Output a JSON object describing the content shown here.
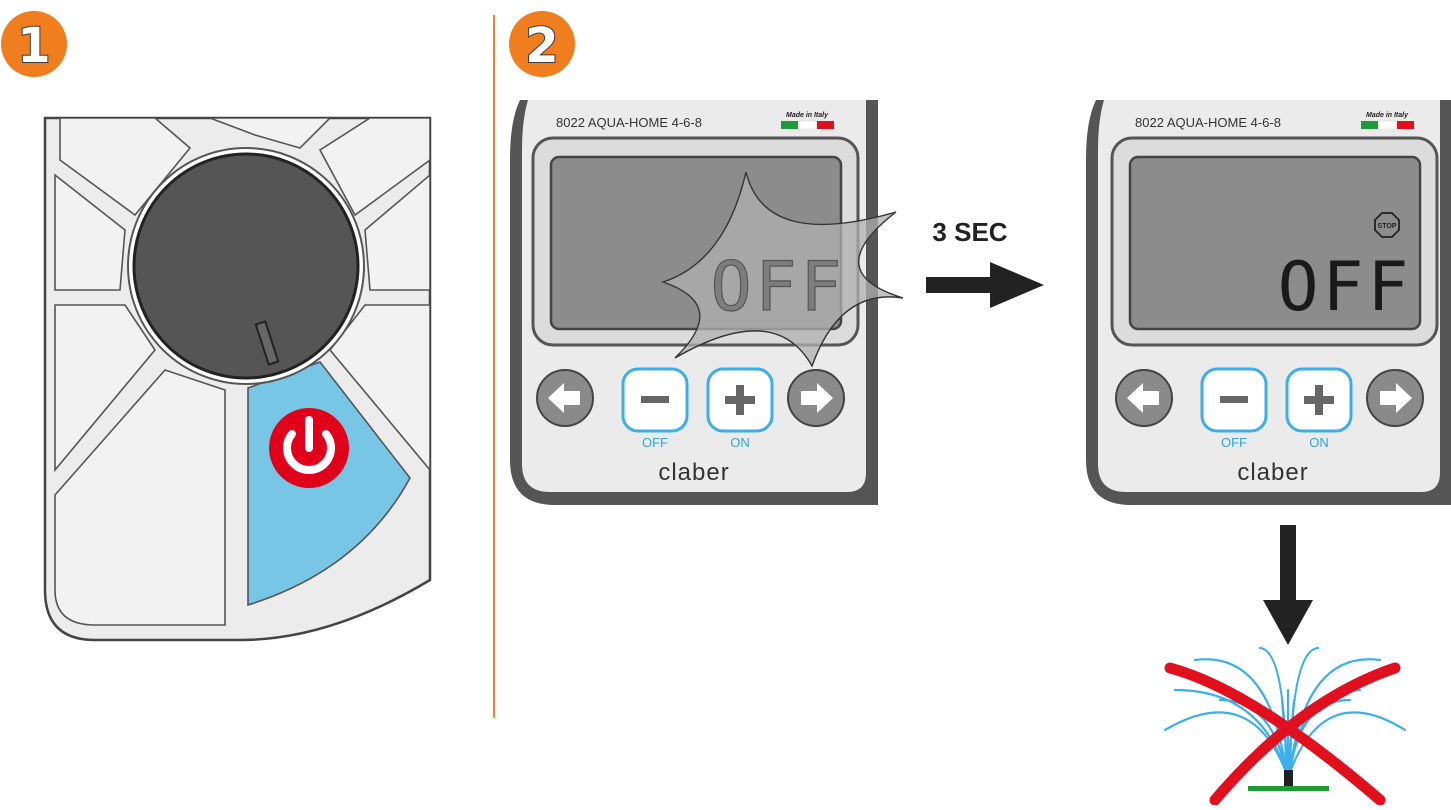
{
  "steps": [
    {
      "number": "1"
    },
    {
      "number": "2"
    }
  ],
  "timer_before": {
    "model_label": "8022  AQUA-HOME 4-6-8",
    "made_in": "Made in Italy",
    "lcd_text": "OFF",
    "minus_label": "OFF",
    "plus_label": "ON",
    "brand": "claber"
  },
  "hold_instruction": "3 SEC",
  "timer_after": {
    "model_label": "8022  AQUA-HOME 4-6-8",
    "made_in": "Made in Italy",
    "stop_icon_text": "STOP",
    "lcd_text": "OFF",
    "minus_label": "OFF",
    "plus_label": "ON",
    "brand": "claber"
  },
  "icons": {
    "power": "power-icon",
    "left": "left-arrow-icon",
    "right": "right-arrow-icon",
    "minus": "minus-icon",
    "plus": "plus-icon",
    "stop": "stop-icon",
    "no_water": "no-watering-icon"
  },
  "colors": {
    "step_badge": "#F07D1E",
    "divider": "#E8823A",
    "power_button": "#E1001A",
    "active_segment": "#78C6E6",
    "button_outline": "#3DAEE9",
    "button_label": "#2BA6DE",
    "lcd_bg": "#8C8C8C",
    "cross": "#E0101E",
    "ground": "#1E9A3B"
  }
}
